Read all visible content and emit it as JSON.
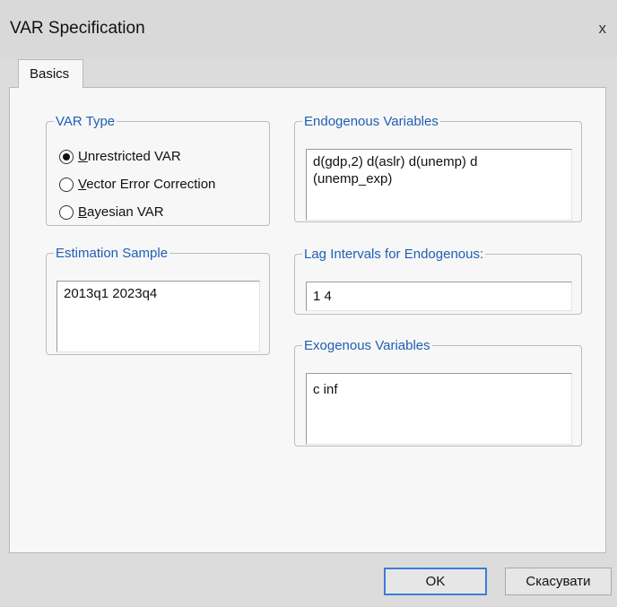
{
  "window": {
    "title": "VAR Specification",
    "close_glyph": "x"
  },
  "tabs": [
    {
      "label": "Basics",
      "active": true
    }
  ],
  "var_type": {
    "legend": "VAR Type",
    "options": [
      {
        "pre": "",
        "accel": "U",
        "post": "nrestricted VAR",
        "selected": true
      },
      {
        "pre": "",
        "accel": "V",
        "post": "ector Error Correction",
        "selected": false
      },
      {
        "pre": "",
        "accel": "B",
        "post": "ayesian VAR",
        "selected": false
      }
    ]
  },
  "endogenous": {
    "legend": "Endogenous Variables",
    "value": "d(gdp,2) d(aslr) d(unemp) d\n(unemp_exp)"
  },
  "estimation_sample": {
    "legend": "Estimation Sample",
    "value": "2013q1 2023q4"
  },
  "lag_intervals": {
    "legend": "Lag Intervals for Endogenous:",
    "value": "1 4"
  },
  "exogenous": {
    "legend": "Exogenous Variables",
    "value": "c inf"
  },
  "buttons": {
    "ok": "OK",
    "cancel": "Скасувати"
  },
  "colors": {
    "accent": "#1f5fb4",
    "default_button_border": "#3b7dd8",
    "window_bg": "#dcdcdc",
    "panel_bg": "#f7f7f7"
  }
}
